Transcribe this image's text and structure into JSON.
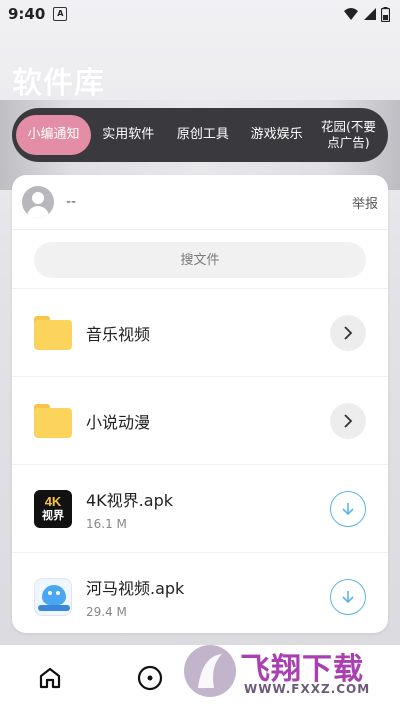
{
  "status_bar": {
    "time": "9:40",
    "notif_letter": "A"
  },
  "app": {
    "title": "软件库"
  },
  "tabs": [
    {
      "label": "小编通知",
      "active": true
    },
    {
      "label": "实用软件",
      "active": false
    },
    {
      "label": "原创工具",
      "active": false
    },
    {
      "label": "游戏娱乐",
      "active": false
    },
    {
      "label": "花园(不要点广告)",
      "active": false
    }
  ],
  "header": {
    "username": "--",
    "report_label": "举报"
  },
  "search": {
    "placeholder": "搜文件"
  },
  "items": [
    {
      "type": "folder",
      "name": "音乐视频",
      "icon": "folder-icon",
      "action_icon": "chevron-right-icon"
    },
    {
      "type": "folder",
      "name": "小说动漫",
      "icon": "folder-icon",
      "action_icon": "chevron-right-icon"
    },
    {
      "type": "file",
      "name": "4K视界.apk",
      "size": "16.1 M",
      "icon_line1": "4K",
      "icon_line2": "视界",
      "action_icon": "download-icon"
    },
    {
      "type": "file",
      "name": "河马视频.apk",
      "size": "29.4 M",
      "action_icon": "download-icon"
    }
  ],
  "bottom_nav": [
    "home-icon",
    "discover-icon"
  ],
  "watermark": {
    "text": "飞翔下载",
    "url": "WWW.FXXZ.COM"
  },
  "colors": {
    "accent_pink": "#e38ea6",
    "tab_bar": "#3a3a3e",
    "download_blue": "#5ab4e8",
    "folder_yellow": "#fcd45b"
  }
}
